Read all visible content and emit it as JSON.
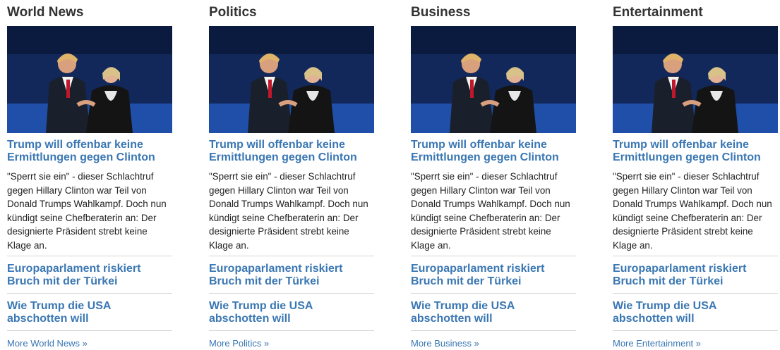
{
  "columns": [
    {
      "category": "World News",
      "lead_headline": "Trump will offenbar keine Ermittlungen gegen Clinton",
      "teaser": "\"Sperrt sie ein\" - dieser Schlachtruf gegen Hillary Clinton war Teil von Donald Trumps Wahlkampf. Doch nun kündigt seine Chefberaterin an: Der designierte Präsident strebt keine Klage an.",
      "headline_2": "Europaparlament riskiert Bruch mit der Türkei",
      "headline_3": "Wie Trump die USA abschotten will",
      "more_label": "More World News »"
    },
    {
      "category": "Politics",
      "lead_headline": "Trump will offenbar keine Ermittlungen gegen Clinton",
      "teaser": "\"Sperrt sie ein\" - dieser Schlachtruf gegen Hillary Clinton war Teil von Donald Trumps Wahlkampf. Doch nun kündigt seine Chefberaterin an: Der designierte Präsident strebt keine Klage an.",
      "headline_2": "Europaparlament riskiert Bruch mit der Türkei",
      "headline_3": "Wie Trump die USA abschotten will",
      "more_label": "More Politics »"
    },
    {
      "category": "Business",
      "lead_headline": "Trump will offenbar keine Ermittlungen gegen Clinton",
      "teaser": "\"Sperrt sie ein\" - dieser Schlachtruf gegen Hillary Clinton war Teil von Donald Trumps Wahlkampf. Doch nun kündigt seine Chefberaterin an: Der designierte Präsident strebt keine Klage an.",
      "headline_2": "Europaparlament riskiert Bruch mit der Türkei",
      "headline_3": "Wie Trump die USA abschotten will",
      "more_label": "More Business »"
    },
    {
      "category": "Entertainment",
      "lead_headline": "Trump will offenbar keine Ermittlungen gegen Clinton",
      "teaser": "\"Sperrt sie ein\" - dieser Schlachtruf gegen Hillary Clinton war Teil von Donald Trumps Wahlkampf. Doch nun kündigt seine Chefberaterin an: Der designierte Präsident strebt keine Klage an.",
      "headline_2": "Europaparlament riskiert Bruch mit der Türkei",
      "headline_3": "Wie Trump die USA abschotten will",
      "more_label": "More Entertainment »"
    }
  ],
  "colors": {
    "link": "#3a77b3",
    "heading": "#333333",
    "body_text": "#222222",
    "divider": "#d6d6d6",
    "photo_backdrop": "#12285a"
  }
}
